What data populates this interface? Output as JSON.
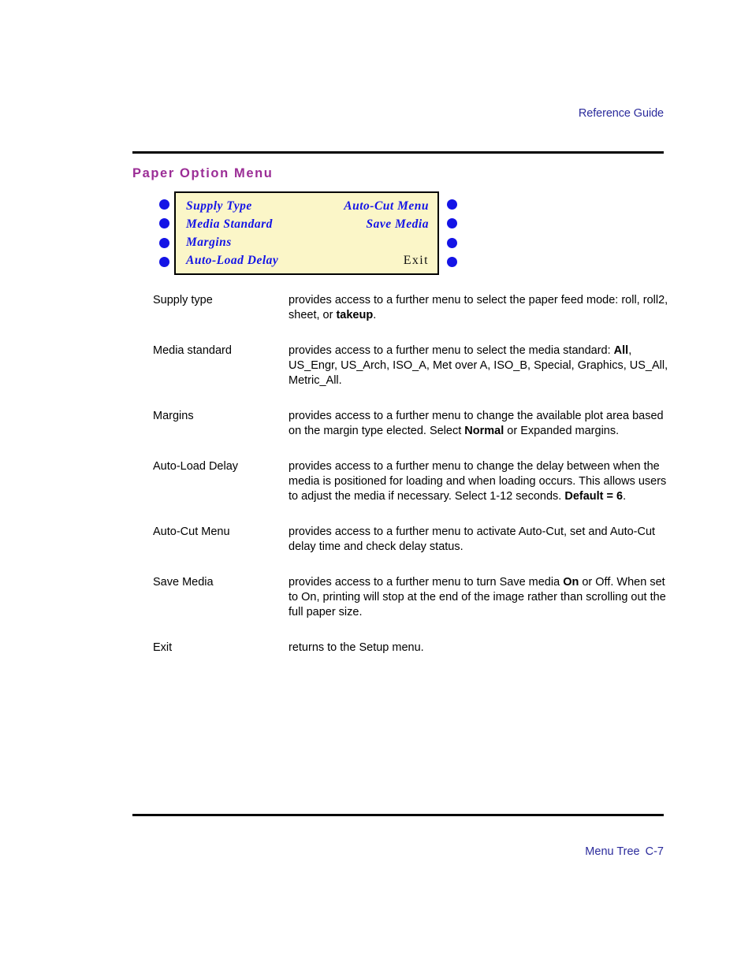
{
  "header": {
    "guide_label": "Reference Guide"
  },
  "footer": {
    "section_label": "Menu Tree",
    "page_number": "C-7"
  },
  "section": {
    "title": "Paper  Option  Menu"
  },
  "colors": {
    "heading_purple": "#9b2d96",
    "link_blue": "#2b2b9c",
    "lcd_background": "#fbf6c8",
    "lcd_text_blue": "#1414e6",
    "rule_black": "#000000"
  },
  "lcd_panel": {
    "rows": [
      {
        "left": "Supply Type",
        "right": "Auto-Cut Menu",
        "right_style": "italic"
      },
      {
        "left": "Media Standard",
        "right": "Save Media",
        "right_style": "italic"
      },
      {
        "left": "Margins",
        "right": "",
        "right_style": "italic"
      },
      {
        "left": "Auto-Load Delay",
        "right": "Exit",
        "right_style": "plain"
      }
    ],
    "left_buttons": [
      "button-1",
      "button-2",
      "button-3",
      "button-4"
    ],
    "right_buttons": [
      "button-5",
      "button-6",
      "button-7",
      "button-8"
    ]
  },
  "definitions": [
    {
      "term": "Supply type",
      "desc_parts": [
        {
          "t": "provides access to a further menu to select the paper feed mode: roll, roll2, sheet, or ",
          "bold": false
        },
        {
          "t": "takeup",
          "bold": true
        },
        {
          "t": ".",
          "bold": false
        }
      ]
    },
    {
      "term": "Media standard",
      "desc_parts": [
        {
          "t": "provides access to a further menu to select the media standard: ",
          "bold": false
        },
        {
          "t": "All",
          "bold": true
        },
        {
          "t": ", US_Engr, US_Arch, ISO_A, Met over A, ISO_B, Special, Graphics, US_All, Metric_All.",
          "bold": false
        }
      ]
    },
    {
      "term": "Margins",
      "desc_parts": [
        {
          "t": "provides access to a further menu to change the available plot area based on the margin type elected. Select ",
          "bold": false
        },
        {
          "t": "Normal",
          "bold": true
        },
        {
          "t": " or Expanded margins.",
          "bold": false
        }
      ]
    },
    {
      "term": "Auto-Load Delay",
      "desc_parts": [
        {
          "t": "provides access to a further menu to change the delay between when the media is positioned for loading and when loading occurs. This allows users to adjust the media if necessary. Select 1-12 seconds. ",
          "bold": false
        },
        {
          "t": "Default = 6",
          "bold": true
        },
        {
          "t": ".",
          "bold": false
        }
      ]
    },
    {
      "term": "Auto-Cut Menu",
      "desc_parts": [
        {
          "t": "provides access to a further menu to activate Auto-Cut, set and Auto-Cut delay time and check delay status.",
          "bold": false
        }
      ]
    },
    {
      "term": "Save Media",
      "desc_parts": [
        {
          "t": "provides access to a further menu to turn Save media ",
          "bold": false
        },
        {
          "t": "On",
          "bold": true
        },
        {
          "t": " or Off. When set to On, printing will stop at the end of the image rather than scrolling out the full paper size.",
          "bold": false
        }
      ]
    },
    {
      "term": "Exit",
      "desc_parts": [
        {
          "t": "returns to the Setup menu.",
          "bold": false
        }
      ]
    }
  ]
}
